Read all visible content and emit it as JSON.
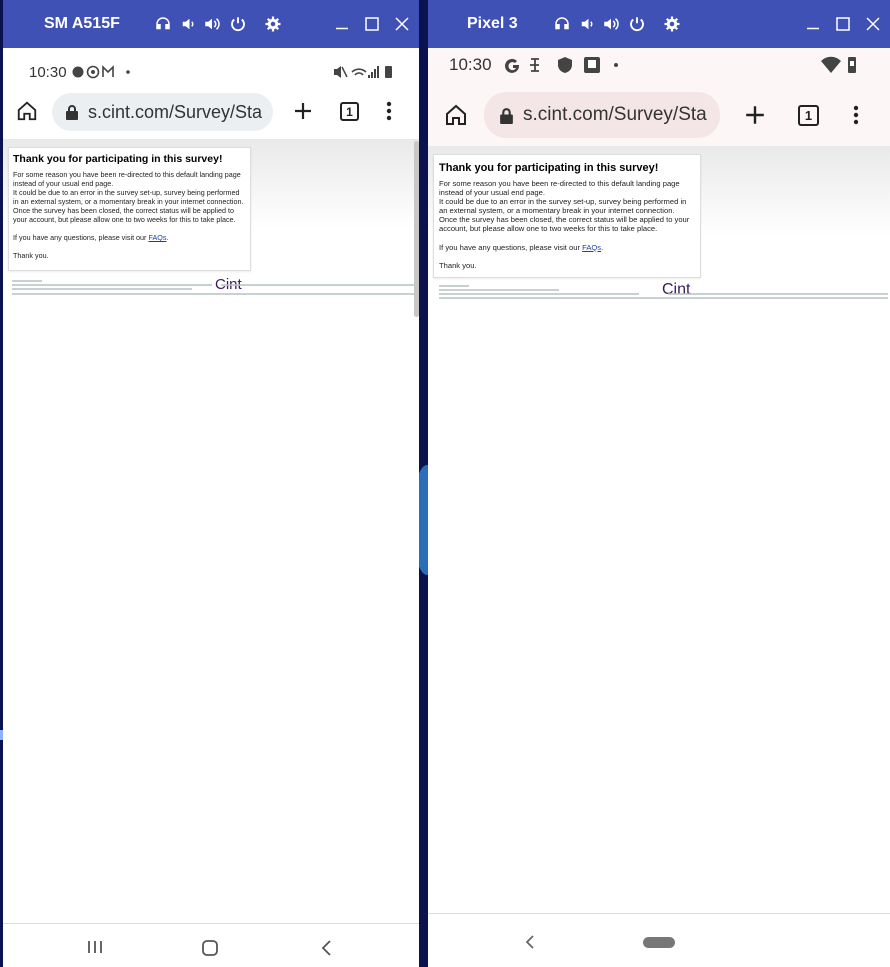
{
  "left_device": {
    "name": "SM A515F",
    "time": "10:30",
    "url": "s.cint.com/Survey/Sta",
    "tab_count": "1"
  },
  "right_device": {
    "name": "Pixel 3",
    "time": "10:30",
    "url": "s.cint.com/Survey/Sta",
    "tab_count": "1"
  },
  "survey": {
    "title": "Thank you for participating in this survey!",
    "para1_left": "For some reason you have been re-directed to this default landing page instead of your usual end page.",
    "para2_left": "It could be due to an error in the survey set-up, survey being performed in an external system, or a momentary break in your internet connection.",
    "para3_left": "Once the survey has been closed, the correct status will be applied to your account, but please allow one to two weeks for this to take place.",
    "questions_prefix": "If you have any questions, please visit our ",
    "faq_link": "FAQs",
    "questions_suffix": ".",
    "thanks": "Thank you.",
    "logo": "Cint"
  },
  "colors": {
    "titlebar": "#3f51b5",
    "desktop": "#0a1250",
    "link": "#1a3ea6"
  }
}
